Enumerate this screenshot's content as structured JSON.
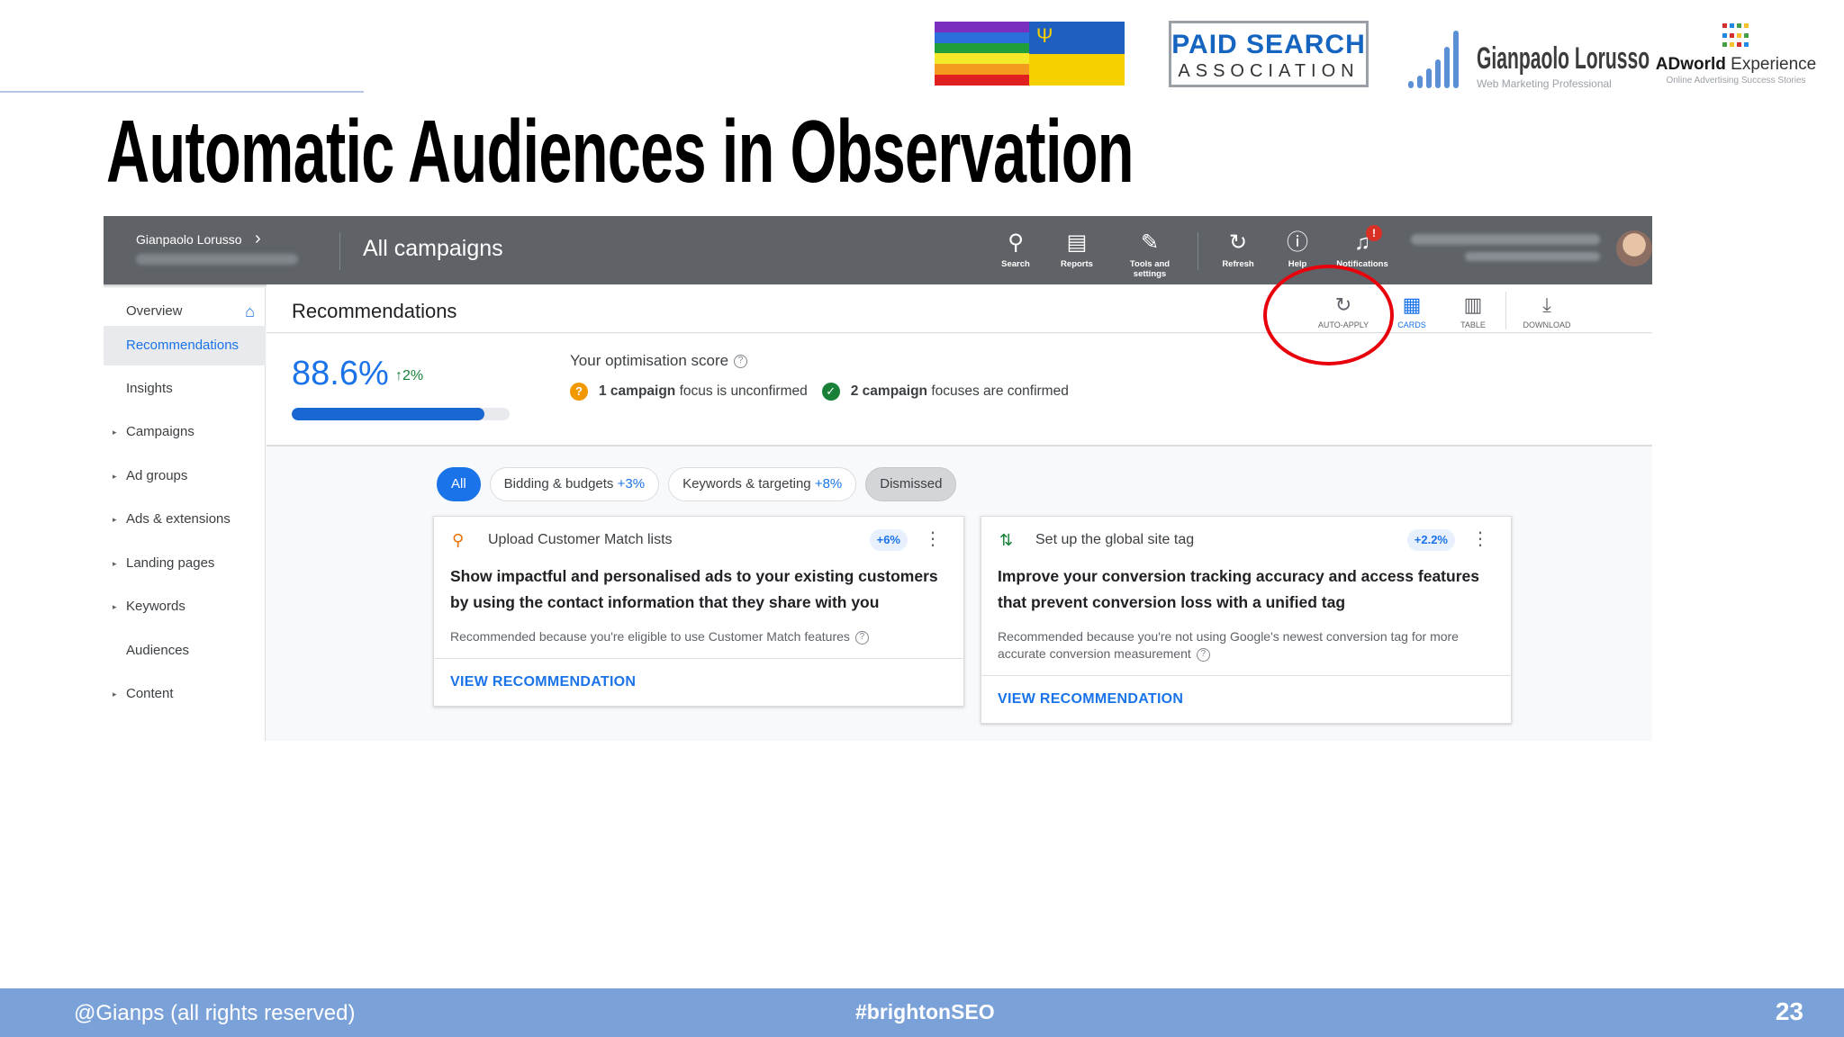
{
  "slide": {
    "title": "Automatic Audiences in Observation",
    "footer_left": "@Gianps (all rights reserved)",
    "footer_center": "#brightonSEO",
    "page_number": "23"
  },
  "logos": {
    "psa_line1": "PAID SEARCH",
    "psa_line2": "ASSOCIATION",
    "gianpaolo_name": "Gianpaolo Lorusso",
    "gianpaolo_sub": "Web Marketing Professional",
    "adworld_name_bold": "ADworld",
    "adworld_name_rest": " Experience",
    "adworld_sub": "Online Advertising Success Stories"
  },
  "colors": {
    "accent_blue": "#1a73e8",
    "topbar_gray": "#5f6368",
    "highlight_red": "#e8000b",
    "footer_blue": "#7aa1d8"
  },
  "ads": {
    "account_name": "Gianpaolo Lorusso",
    "page_title": "All campaigns",
    "tools": [
      {
        "icon": "search-icon",
        "glyph": "🔍",
        "label": "Search"
      },
      {
        "icon": "reports-icon",
        "glyph": "📊",
        "label": "Reports"
      },
      {
        "icon": "wrench-icon",
        "glyph": "🔧",
        "label": "Tools and settings"
      },
      {
        "icon": "refresh-icon",
        "glyph": "↻",
        "label": "Refresh"
      },
      {
        "icon": "help-icon",
        "glyph": "?",
        "label": "Help"
      },
      {
        "icon": "bell-icon",
        "glyph": "🔔",
        "label": "Notifications"
      }
    ],
    "notification_badge": "!",
    "sidebar": [
      {
        "label": "Overview",
        "caret": false
      },
      {
        "label": "Recommendations",
        "caret": false
      },
      {
        "label": "Insights",
        "caret": false
      },
      {
        "label": "Campaigns",
        "caret": true
      },
      {
        "label": "Ad groups",
        "caret": true
      },
      {
        "label": "Ads & extensions",
        "caret": true
      },
      {
        "label": "Landing pages",
        "caret": true
      },
      {
        "label": "Keywords",
        "caret": true
      },
      {
        "label": "Audiences",
        "caret": false
      },
      {
        "label": "Content",
        "caret": true
      }
    ],
    "section_title": "Recommendations",
    "views": [
      {
        "icon": "auto-apply-icon",
        "glyph": "↻",
        "label": "AUTO-APPLY"
      },
      {
        "icon": "cards-icon",
        "glyph": "▦",
        "label": "CARDS"
      },
      {
        "icon": "table-icon",
        "glyph": "▥",
        "label": "TABLE"
      },
      {
        "icon": "download-icon",
        "glyph": "⤓",
        "label": "DOWNLOAD"
      }
    ],
    "score": {
      "value": "88.6%",
      "delta": "↑2%",
      "fill_fraction": 0.886,
      "title": "Your optimisation score",
      "unconfirmed_bold": "1 campaign",
      "unconfirmed_rest": " focus is unconfirmed",
      "confirmed_bold": "2 campaign",
      "confirmed_rest": " focuses are confirmed"
    },
    "filters": {
      "all": "All",
      "bidding": "Bidding & budgets",
      "bidding_pct": "+3%",
      "keywords": "Keywords & targeting",
      "keywords_pct": "+8%",
      "dismissed": "Dismissed"
    },
    "cards": [
      {
        "icon": "magnifier-icon",
        "name": "Upload Customer Match lists",
        "badge": "+6%",
        "body": "Show impactful and personalised ads to your existing customers by using the contact information that they share with you",
        "why": "Recommended because you're eligible to use Customer Match features",
        "cta": "VIEW RECOMMENDATION"
      },
      {
        "icon": "sort-arrows-icon",
        "name": "Set up the global site tag",
        "badge": "+2.2%",
        "body": "Improve your conversion tracking accuracy and access features that prevent conversion loss with a unified tag",
        "why": "Recommended because you're not using Google's newest conversion tag for more accurate conversion measurement",
        "cta": "VIEW RECOMMENDATION"
      }
    ]
  }
}
